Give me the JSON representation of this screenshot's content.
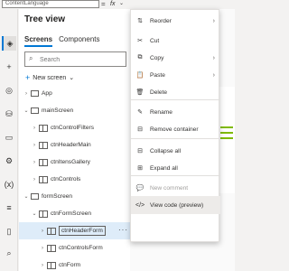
{
  "formula_bar": {
    "property": "ContentLanguage",
    "equals": "=",
    "fx": "fx"
  },
  "tree_view": {
    "title": "Tree view",
    "tabs": [
      {
        "label": "Screens",
        "active": true
      },
      {
        "label": "Components",
        "active": false
      }
    ],
    "search_placeholder": "Search",
    "new_screen_label": "New screen"
  },
  "tree": [
    {
      "label": "App",
      "indent": 1,
      "chevron": "›",
      "icon": "screen",
      "boxed": false
    },
    {
      "label": "mainScreen",
      "indent": 1,
      "chevron": "⌄",
      "icon": "screen",
      "boxed": false
    },
    {
      "label": "ctnControlFilters",
      "indent": 2,
      "chevron": "›",
      "icon": "container",
      "boxed": false
    },
    {
      "label": "ctnHeaderMain",
      "indent": 2,
      "chevron": "›",
      "icon": "container",
      "boxed": false
    },
    {
      "label": "ctnItensGallery",
      "indent": 2,
      "chevron": "›",
      "icon": "container",
      "boxed": false
    },
    {
      "label": "ctnControls",
      "indent": 2,
      "chevron": "›",
      "icon": "container",
      "boxed": false
    },
    {
      "label": "formScreen",
      "indent": 1,
      "chevron": "⌄",
      "icon": "screen",
      "boxed": false
    },
    {
      "label": "ctnFormScreen",
      "indent": 2,
      "chevron": "⌄",
      "icon": "container",
      "boxed": false
    },
    {
      "label": "ctnHeaderForm",
      "indent": 3,
      "chevron": "›",
      "icon": "container",
      "boxed": true,
      "selected": true,
      "more": "···"
    },
    {
      "label": "ctnControlsForm",
      "indent": 3,
      "chevron": "›",
      "icon": "container",
      "boxed": false
    },
    {
      "label": "ctnForm",
      "indent": 3,
      "chevron": "›",
      "icon": "container",
      "boxed": false
    }
  ],
  "context_menu": {
    "items": [
      {
        "label": "Reorder",
        "icon": "⇅",
        "icon_name": "reorder-icon",
        "submenu": true
      },
      {
        "label": "Cut",
        "icon": "✂",
        "icon_name": "cut-icon",
        "submenu": false
      },
      {
        "label": "Copy",
        "icon": "⧉",
        "icon_name": "copy-icon",
        "submenu": true
      },
      {
        "label": "Paste",
        "icon": "📋",
        "icon_name": "paste-icon",
        "submenu": true
      },
      {
        "label": "Delete",
        "icon": "🗑",
        "icon_name": "delete-icon",
        "submenu": false
      },
      {
        "label": "Rename",
        "icon": "✎",
        "icon_name": "rename-icon",
        "submenu": false
      },
      {
        "label": "Remove container",
        "icon": "⊟",
        "icon_name": "remove-container-icon",
        "submenu": false
      },
      {
        "label": "Collapse all",
        "icon": "⊟",
        "icon_name": "collapse-all-icon",
        "submenu": false
      },
      {
        "label": "Expand all",
        "icon": "⊞",
        "icon_name": "expand-all-icon",
        "submenu": false
      },
      {
        "label": "New comment",
        "icon": "💬",
        "icon_name": "comment-icon",
        "submenu": false,
        "disabled": true
      },
      {
        "label": "View code (preview)",
        "icon": "</>",
        "icon_name": "code-icon",
        "submenu": false,
        "hover": true
      }
    ]
  },
  "colors": {
    "accent": "#0078d4",
    "selected_row": "#deecf9",
    "menu_hover": "#edebe9",
    "canvas_green": "#7fba00"
  }
}
